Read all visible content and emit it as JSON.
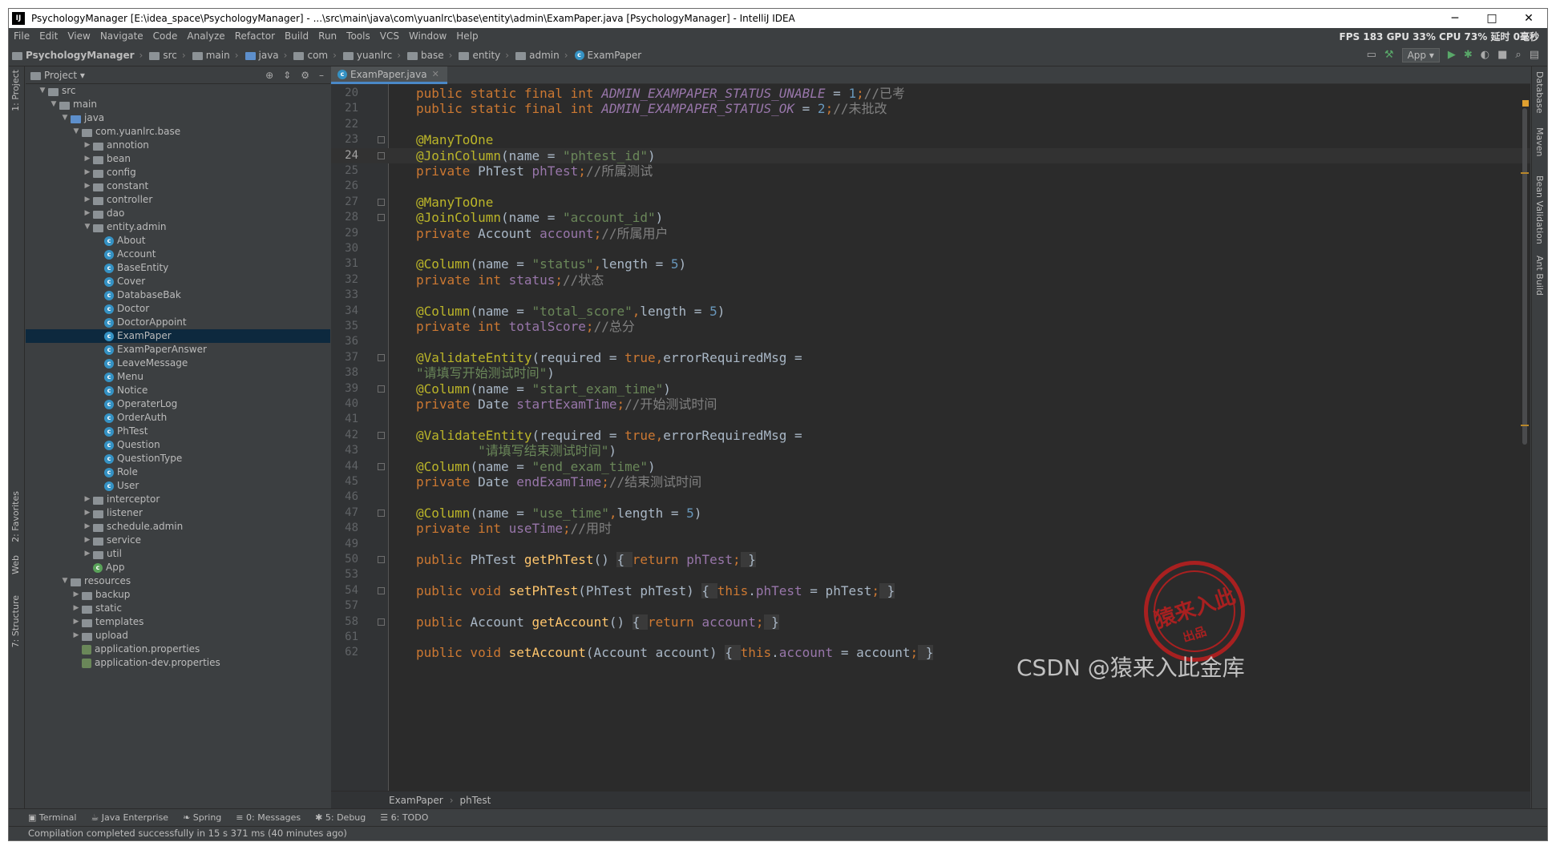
{
  "window": {
    "title": "PsychologyManager [E:\\idea_space\\PsychologyManager] - ...\\src\\main\\java\\com\\yuanlrc\\base\\entity\\admin\\ExamPaper.java [PsychologyManager] - IntelliJ IDEA",
    "app_icon": "IJ",
    "minimize": "─",
    "maximize": "□",
    "close": "✕"
  },
  "menu": [
    "File",
    "Edit",
    "View",
    "Navigate",
    "Code",
    "Analyze",
    "Refactor",
    "Build",
    "Run",
    "Tools",
    "VCS",
    "Window",
    "Help"
  ],
  "perf": "FPS 183 GPU 33% CPU 73% 延时 0毫秒",
  "breadcrumbs": [
    "PsychologyManager",
    "src",
    "main",
    "java",
    "com",
    "yuanlrc",
    "base",
    "entity",
    "admin",
    "ExamPaper"
  ],
  "run_config": "App",
  "left_strip": [
    "1: Project",
    "2: Favorites",
    "Web",
    "7: Structure"
  ],
  "right_strip": [
    "Database",
    "Maven",
    "Bean Validation",
    "Ant Build"
  ],
  "project": {
    "header": "Project",
    "tree": [
      {
        "label": "src",
        "depth": 1,
        "open": true,
        "icon": "folder"
      },
      {
        "label": "main",
        "depth": 2,
        "open": true,
        "icon": "folder"
      },
      {
        "label": "java",
        "depth": 3,
        "open": true,
        "icon": "folder-blue"
      },
      {
        "label": "com.yuanlrc.base",
        "depth": 4,
        "open": true,
        "icon": "folder"
      },
      {
        "label": "annotion",
        "depth": 5,
        "open": false,
        "icon": "folder"
      },
      {
        "label": "bean",
        "depth": 5,
        "open": false,
        "icon": "folder"
      },
      {
        "label": "config",
        "depth": 5,
        "open": false,
        "icon": "folder"
      },
      {
        "label": "constant",
        "depth": 5,
        "open": false,
        "icon": "folder"
      },
      {
        "label": "controller",
        "depth": 5,
        "open": false,
        "icon": "folder"
      },
      {
        "label": "dao",
        "depth": 5,
        "open": false,
        "icon": "folder"
      },
      {
        "label": "entity.admin",
        "depth": 5,
        "open": true,
        "icon": "folder"
      },
      {
        "label": "About",
        "depth": 6,
        "icon": "class"
      },
      {
        "label": "Account",
        "depth": 6,
        "icon": "class"
      },
      {
        "label": "BaseEntity",
        "depth": 6,
        "icon": "class"
      },
      {
        "label": "Cover",
        "depth": 6,
        "icon": "class"
      },
      {
        "label": "DatabaseBak",
        "depth": 6,
        "icon": "class"
      },
      {
        "label": "Doctor",
        "depth": 6,
        "icon": "class"
      },
      {
        "label": "DoctorAppoint",
        "depth": 6,
        "icon": "class"
      },
      {
        "label": "ExamPaper",
        "depth": 6,
        "icon": "class",
        "selected": true
      },
      {
        "label": "ExamPaperAnswer",
        "depth": 6,
        "icon": "class"
      },
      {
        "label": "LeaveMessage",
        "depth": 6,
        "icon": "class"
      },
      {
        "label": "Menu",
        "depth": 6,
        "icon": "class"
      },
      {
        "label": "Notice",
        "depth": 6,
        "icon": "class"
      },
      {
        "label": "OperaterLog",
        "depth": 6,
        "icon": "class"
      },
      {
        "label": "OrderAuth",
        "depth": 6,
        "icon": "class"
      },
      {
        "label": "PhTest",
        "depth": 6,
        "icon": "class"
      },
      {
        "label": "Question",
        "depth": 6,
        "icon": "class"
      },
      {
        "label": "QuestionType",
        "depth": 6,
        "icon": "class"
      },
      {
        "label": "Role",
        "depth": 6,
        "icon": "class"
      },
      {
        "label": "User",
        "depth": 6,
        "icon": "class"
      },
      {
        "label": "interceptor",
        "depth": 5,
        "open": false,
        "icon": "folder"
      },
      {
        "label": "listener",
        "depth": 5,
        "open": false,
        "icon": "folder"
      },
      {
        "label": "schedule.admin",
        "depth": 5,
        "open": false,
        "icon": "folder"
      },
      {
        "label": "service",
        "depth": 5,
        "open": false,
        "icon": "folder"
      },
      {
        "label": "util",
        "depth": 5,
        "open": false,
        "icon": "folder"
      },
      {
        "label": "App",
        "depth": 5,
        "icon": "class-app"
      },
      {
        "label": "resources",
        "depth": 3,
        "open": true,
        "icon": "folder"
      },
      {
        "label": "backup",
        "depth": 4,
        "open": false,
        "icon": "folder"
      },
      {
        "label": "static",
        "depth": 4,
        "open": false,
        "icon": "folder"
      },
      {
        "label": "templates",
        "depth": 4,
        "open": false,
        "icon": "folder"
      },
      {
        "label": "upload",
        "depth": 4,
        "open": false,
        "icon": "folder"
      },
      {
        "label": "application.properties",
        "depth": 4,
        "icon": "props"
      },
      {
        "label": "application-dev.properties",
        "depth": 4,
        "icon": "props"
      }
    ]
  },
  "editor": {
    "tab": "ExamPaper.java",
    "current_line": "24",
    "lines": [
      {
        "n": "20",
        "tokens": [
          [
            "kw",
            "public static final int "
          ],
          [
            "sfld",
            "ADMIN_EXAMPAPER_STATUS_UNABLE"
          ],
          [
            "p",
            " = "
          ],
          [
            "num",
            "1"
          ],
          [
            "kw",
            ";"
          ],
          [
            "cmt",
            "//已考"
          ]
        ]
      },
      {
        "n": "21",
        "tokens": [
          [
            "kw",
            "public static final int "
          ],
          [
            "sfld",
            "ADMIN_EXAMPAPER_STATUS_OK"
          ],
          [
            "p",
            " = "
          ],
          [
            "num",
            "2"
          ],
          [
            "kw",
            ";"
          ],
          [
            "cmt",
            "//未批改"
          ]
        ]
      },
      {
        "n": "22",
        "tokens": []
      },
      {
        "n": "23",
        "fold": true,
        "tokens": [
          [
            "ann",
            "@ManyToOne"
          ]
        ]
      },
      {
        "n": "24",
        "fold": true,
        "tokens": [
          [
            "ann",
            "@JoinColumn"
          ],
          [
            "p",
            "(name = "
          ],
          [
            "str",
            "\"phtest_id\""
          ],
          [
            "p",
            ")"
          ]
        ]
      },
      {
        "n": "25",
        "tokens": [
          [
            "kw",
            "private "
          ],
          [
            "p",
            "PhTest "
          ],
          [
            "fld",
            "phTest"
          ],
          [
            "kw",
            ";"
          ],
          [
            "cmt",
            "//所属测试"
          ]
        ]
      },
      {
        "n": "26",
        "tokens": []
      },
      {
        "n": "27",
        "fold": true,
        "tokens": [
          [
            "ann",
            "@ManyToOne"
          ]
        ]
      },
      {
        "n": "28",
        "fold": true,
        "tokens": [
          [
            "ann",
            "@JoinColumn"
          ],
          [
            "p",
            "(name = "
          ],
          [
            "str",
            "\"account_id\""
          ],
          [
            "p",
            ")"
          ]
        ]
      },
      {
        "n": "29",
        "tokens": [
          [
            "kw",
            "private "
          ],
          [
            "p",
            "Account "
          ],
          [
            "fld",
            "account"
          ],
          [
            "kw",
            ";"
          ],
          [
            "cmt",
            "//所属用户"
          ]
        ]
      },
      {
        "n": "30",
        "tokens": []
      },
      {
        "n": "31",
        "tokens": [
          [
            "ann",
            "@Column"
          ],
          [
            "p",
            "(name = "
          ],
          [
            "str",
            "\"status\""
          ],
          [
            "kw",
            ","
          ],
          [
            "p",
            "length = "
          ],
          [
            "num",
            "5"
          ],
          [
            "p",
            ")"
          ]
        ]
      },
      {
        "n": "32",
        "tokens": [
          [
            "kw",
            "private int "
          ],
          [
            "fld",
            "status"
          ],
          [
            "kw",
            ";"
          ],
          [
            "cmt",
            "//状态"
          ]
        ]
      },
      {
        "n": "33",
        "tokens": []
      },
      {
        "n": "34",
        "tokens": [
          [
            "ann",
            "@Column"
          ],
          [
            "p",
            "(name = "
          ],
          [
            "str",
            "\"total_score\""
          ],
          [
            "kw",
            ","
          ],
          [
            "p",
            "length = "
          ],
          [
            "num",
            "5"
          ],
          [
            "p",
            ")"
          ]
        ]
      },
      {
        "n": "35",
        "tokens": [
          [
            "kw",
            "private int "
          ],
          [
            "fld",
            "totalScore"
          ],
          [
            "kw",
            ";"
          ],
          [
            "cmt",
            "//总分"
          ]
        ]
      },
      {
        "n": "36",
        "tokens": []
      },
      {
        "n": "37",
        "fold": true,
        "tokens": [
          [
            "ann",
            "@ValidateEntity"
          ],
          [
            "p",
            "(required = "
          ],
          [
            "kw",
            "true,"
          ],
          [
            "p",
            "errorRequiredMsg ="
          ]
        ]
      },
      {
        "n": "38",
        "tokens": [
          [
            "str",
            "\"请填写开始测试时间\""
          ],
          [
            "p",
            ")"
          ]
        ]
      },
      {
        "n": "39",
        "fold": true,
        "tokens": [
          [
            "ann",
            "@Column"
          ],
          [
            "p",
            "(name = "
          ],
          [
            "str",
            "\"start_exam_time\""
          ],
          [
            "p",
            ")"
          ]
        ]
      },
      {
        "n": "40",
        "tokens": [
          [
            "kw",
            "private "
          ],
          [
            "p",
            "Date "
          ],
          [
            "fld",
            "startExamTime"
          ],
          [
            "kw",
            ";"
          ],
          [
            "cmt",
            "//开始测试时间"
          ]
        ]
      },
      {
        "n": "41",
        "tokens": []
      },
      {
        "n": "42",
        "fold": true,
        "tokens": [
          [
            "ann",
            "@ValidateEntity"
          ],
          [
            "p",
            "(required = "
          ],
          [
            "kw",
            "true,"
          ],
          [
            "p",
            "errorRequiredMsg ="
          ]
        ]
      },
      {
        "n": "43",
        "tokens": [
          [
            "p",
            "        "
          ],
          [
            "str",
            "\"请填写结束测试时间\""
          ],
          [
            "p",
            ")"
          ]
        ]
      },
      {
        "n": "44",
        "fold": true,
        "tokens": [
          [
            "ann",
            "@Column"
          ],
          [
            "p",
            "(name = "
          ],
          [
            "str",
            "\"end_exam_time\""
          ],
          [
            "p",
            ")"
          ]
        ]
      },
      {
        "n": "45",
        "tokens": [
          [
            "kw",
            "private "
          ],
          [
            "p",
            "Date "
          ],
          [
            "fld",
            "endExamTime"
          ],
          [
            "kw",
            ";"
          ],
          [
            "cmt",
            "//结束测试时间"
          ]
        ]
      },
      {
        "n": "46",
        "tokens": []
      },
      {
        "n": "47",
        "fold": true,
        "tokens": [
          [
            "ann",
            "@Column"
          ],
          [
            "p",
            "(name = "
          ],
          [
            "str",
            "\"use_time\""
          ],
          [
            "kw",
            ","
          ],
          [
            "p",
            "length = "
          ],
          [
            "num",
            "5"
          ],
          [
            "p",
            ")"
          ]
        ]
      },
      {
        "n": "48",
        "tokens": [
          [
            "kw",
            "private int "
          ],
          [
            "fld",
            "useTime"
          ],
          [
            "kw",
            ";"
          ],
          [
            "cmt",
            "//用时"
          ]
        ]
      },
      {
        "n": "49",
        "tokens": []
      },
      {
        "n": "50",
        "fold": true,
        "tokens": [
          [
            "kw",
            "public "
          ],
          [
            "p",
            "PhTest "
          ],
          [
            "mth",
            "getPhTest"
          ],
          [
            "p",
            "() "
          ],
          [
            "fb",
            "{ "
          ],
          [
            "kw",
            "return "
          ],
          [
            "fld",
            "phTest"
          ],
          [
            "kw",
            ";"
          ],
          [
            "fb",
            " }"
          ]
        ]
      },
      {
        "n": "53",
        "tokens": []
      },
      {
        "n": "54",
        "fold": true,
        "tokens": [
          [
            "kw",
            "public void "
          ],
          [
            "mth",
            "setPhTest"
          ],
          [
            "p",
            "(PhTest phTest) "
          ],
          [
            "fb",
            "{ "
          ],
          [
            "kw",
            "this"
          ],
          [
            "p",
            "."
          ],
          [
            "fld",
            "phTest"
          ],
          [
            "p",
            " = phTest"
          ],
          [
            "kw",
            ";"
          ],
          [
            "fb",
            " }"
          ]
        ]
      },
      {
        "n": "57",
        "tokens": []
      },
      {
        "n": "58",
        "fold": true,
        "tokens": [
          [
            "kw",
            "public "
          ],
          [
            "p",
            "Account "
          ],
          [
            "mth",
            "getAccount"
          ],
          [
            "p",
            "() "
          ],
          [
            "fb",
            "{ "
          ],
          [
            "kw",
            "return "
          ],
          [
            "fld",
            "account"
          ],
          [
            "kw",
            ";"
          ],
          [
            "fb",
            " }"
          ]
        ]
      },
      {
        "n": "61",
        "tokens": []
      },
      {
        "n": "62",
        "tokens": [
          [
            "kw",
            "public void "
          ],
          [
            "mth",
            "setAccount"
          ],
          [
            "p",
            "(Account account) "
          ],
          [
            "fb",
            "{ "
          ],
          [
            "kw",
            "this"
          ],
          [
            "p",
            "."
          ],
          [
            "fld",
            "account"
          ],
          [
            "p",
            " = account"
          ],
          [
            "kw",
            ";"
          ],
          [
            "fb",
            " }"
          ]
        ]
      }
    ],
    "breadcrumb": [
      "ExamPaper",
      "phTest"
    ]
  },
  "bottom_tabs": [
    "Terminal",
    "Java Enterprise",
    "Spring",
    "0: Messages",
    "5: Debug",
    "6: TODO"
  ],
  "status": "Compilation completed successfully in 15 s 371 ms (40 minutes ago)",
  "stamp": {
    "line1": "猿来入此",
    "line2": "出品"
  },
  "watermark": "CSDN @猿来入此金库",
  "colors": {
    "bg": "#3c3f41",
    "editor_bg": "#2b2b2b",
    "keyword": "#cc7832",
    "annotation": "#bbb529",
    "string": "#6a8759",
    "number": "#6897bb",
    "field": "#9876aa",
    "comment": "#808080",
    "method": "#ffc66d",
    "selection": "#0d293e"
  }
}
